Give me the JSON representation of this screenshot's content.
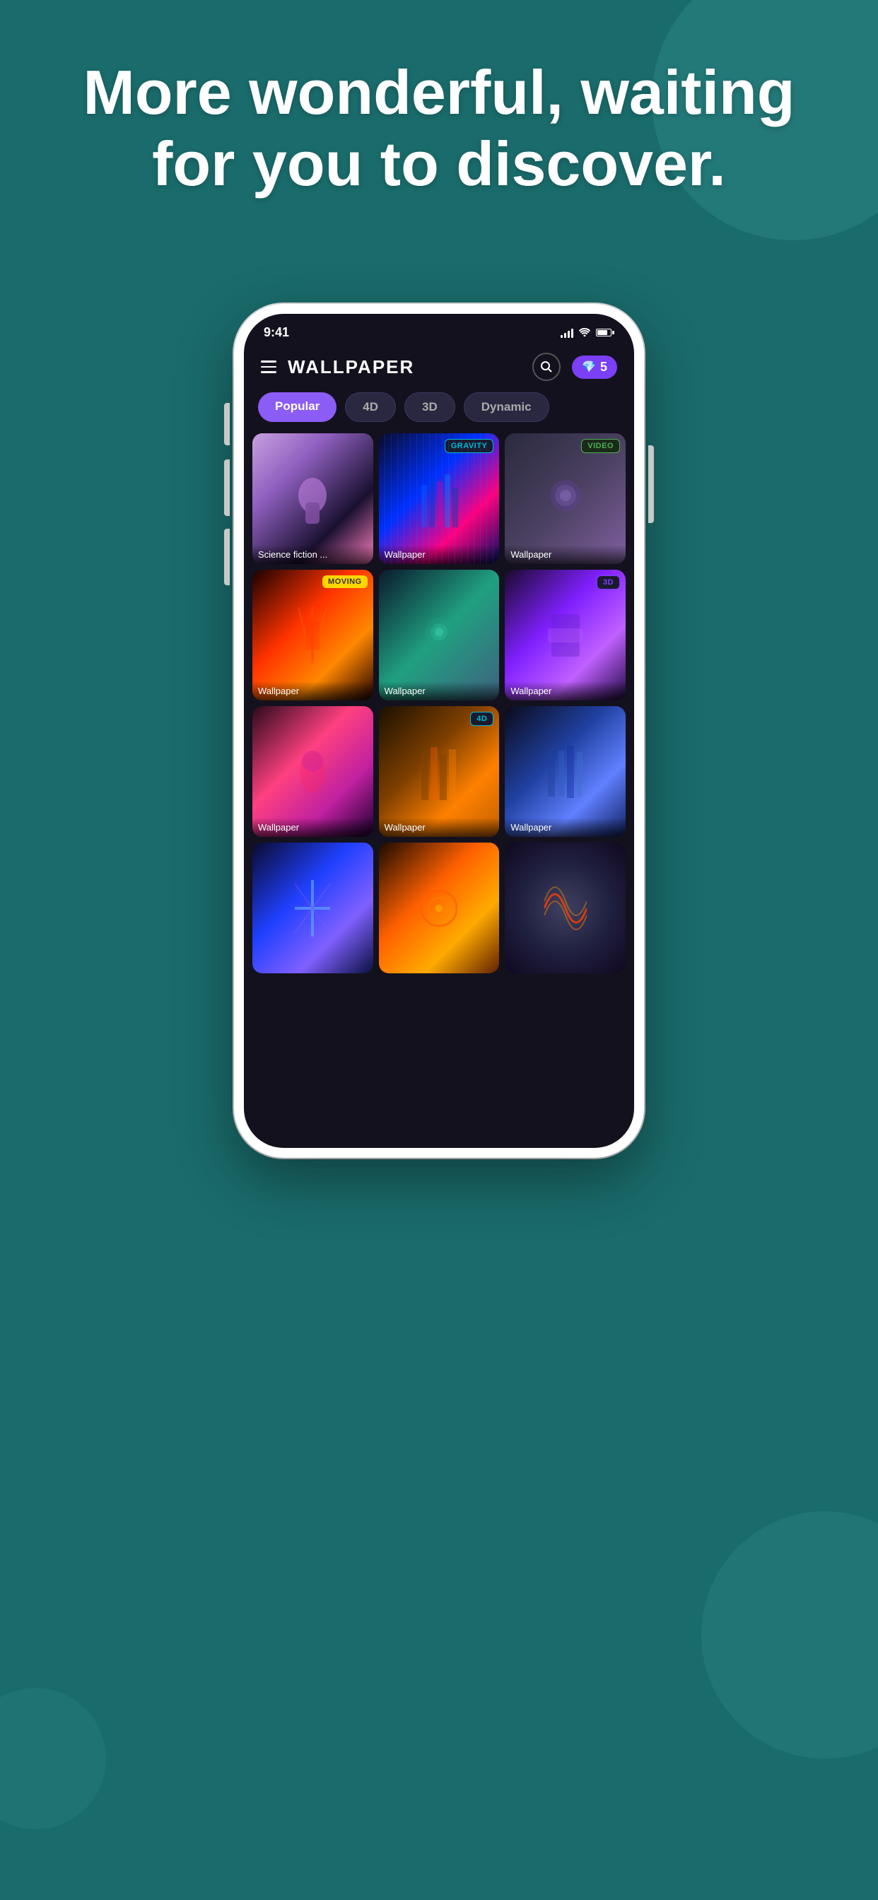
{
  "background": {
    "color": "#1a6b6b"
  },
  "hero": {
    "title": "More wonderful, waiting for you to discover."
  },
  "status_bar": {
    "time": "9:41",
    "signal": "signal",
    "wifi": "wifi",
    "battery": "battery"
  },
  "app": {
    "title": "WALLPAPER",
    "gems_count": "5",
    "tabs": [
      {
        "label": "Popular",
        "active": true
      },
      {
        "label": "4D",
        "active": false
      },
      {
        "label": "3D",
        "active": false
      },
      {
        "label": "Dynamic",
        "active": false
      }
    ]
  },
  "wallpapers": [
    {
      "label": "Science fiction ...",
      "badge": null,
      "badge_type": null,
      "style": "wp1"
    },
    {
      "label": "Wallpaper",
      "badge": "GRAVITY",
      "badge_type": "gravity",
      "style": "wp2"
    },
    {
      "label": "Wallpaper",
      "badge": "VIDEO",
      "badge_type": "video",
      "style": "wp3"
    },
    {
      "label": "Wallpaper",
      "badge": "MOVING",
      "badge_type": "moving",
      "style": "wp4"
    },
    {
      "label": "Wallpaper",
      "badge": null,
      "badge_type": null,
      "style": "wp5"
    },
    {
      "label": "Wallpaper",
      "badge": "3D",
      "badge_type": "3d",
      "style": "wp6"
    },
    {
      "label": "Wallpaper",
      "badge": null,
      "badge_type": null,
      "style": "wp7"
    },
    {
      "label": "Wallpaper",
      "badge": "4D",
      "badge_type": "4d",
      "style": "wp8"
    },
    {
      "label": "Wallpaper",
      "badge": null,
      "badge_type": null,
      "style": "wp9"
    },
    {
      "label": "",
      "badge": null,
      "badge_type": null,
      "style": "wp10"
    },
    {
      "label": "",
      "badge": null,
      "badge_type": null,
      "style": "wp11"
    },
    {
      "label": "",
      "badge": null,
      "badge_type": null,
      "style": "wp12"
    }
  ],
  "icons": {
    "hamburger": "≡",
    "search": "⌕",
    "gem": "💎"
  }
}
